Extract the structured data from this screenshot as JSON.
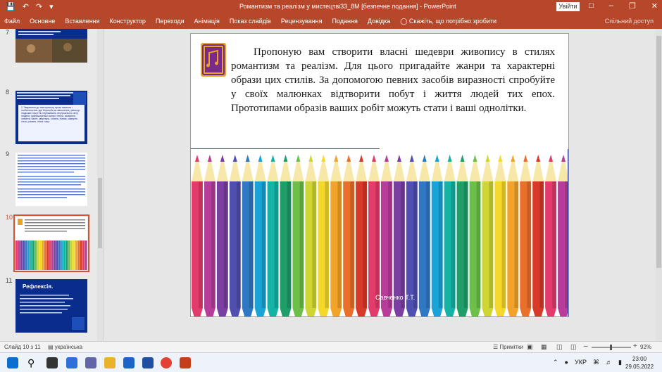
{
  "titlebar": {
    "title": "Романтизм та реалізм у мистецтві33_8М [безпечне подання]  -  PowerPoint",
    "signin_label": "Увійти",
    "save_icon": "save-icon",
    "undo_icon": "undo-icon",
    "redo_icon": "redo-icon"
  },
  "ribbon": {
    "tabs": [
      "Файл",
      "Основне",
      "Вставлення",
      "Конструктор",
      "Переходи",
      "Анімація",
      "Показ слайдів",
      "Рецензування",
      "Подання",
      "Довідка"
    ],
    "tell_me": "Скажіть, що потрібно зробити",
    "share": "Спільний доступ"
  },
  "thumbnails": [
    {
      "num": "7"
    },
    {
      "num": "8",
      "text": "1. Звернення до тем протесту проти насилля і гнобительства, ідеї боротьби за звільнення, увага до людських почуттів, переживань, внутрішнього світу людини; найпоширеніші жанри: опера, симфонія, оперета, балет, увертюра, соната, поема, камерна п'єса, романс, пісня тощо."
    },
    {
      "num": "9"
    },
    {
      "num": "10"
    },
    {
      "num": "11",
      "text": "Рефлексія."
    }
  ],
  "slide": {
    "body": "Пропоную вам створити власні шедеври живопису в стилях романтизм та реалізм. Для цього пригадайте жанри та характерні образи цих стилів. За допомогою певних засобів виразності спробуйте у своїх малюнках відтворити побут і життя людей тих епох. Прототипами образів ваших робіт можуть стати і ваші однолітки.",
    "author": "Савченко Т.Т.",
    "pencil_colors": [
      "#e33b6b",
      "#b83c9a",
      "#7a3fa0",
      "#4f4fb0",
      "#2f78c4",
      "#19a3d6",
      "#14b3a6",
      "#1f9e6a",
      "#6cc04a",
      "#cfd634",
      "#f4d92a",
      "#f2a42a",
      "#ea6f2a",
      "#d83a2a",
      "#e33b6b",
      "#b83c9a",
      "#7a3fa0",
      "#4f4fb0",
      "#2f78c4",
      "#19a3d6",
      "#14b3a6",
      "#1f9e6a",
      "#6cc04a",
      "#cfd634",
      "#f4d92a",
      "#f2a42a",
      "#ea6f2a",
      "#d83a2a",
      "#e33b6b",
      "#b83c9a"
    ]
  },
  "status": {
    "slide_no": "Слайд 10 з 11",
    "language": "українська",
    "notes": "Примітки",
    "zoom": "92%"
  },
  "taskbar": {
    "lang": "УКР",
    "time": "23:00",
    "date": "29.05.2022"
  }
}
